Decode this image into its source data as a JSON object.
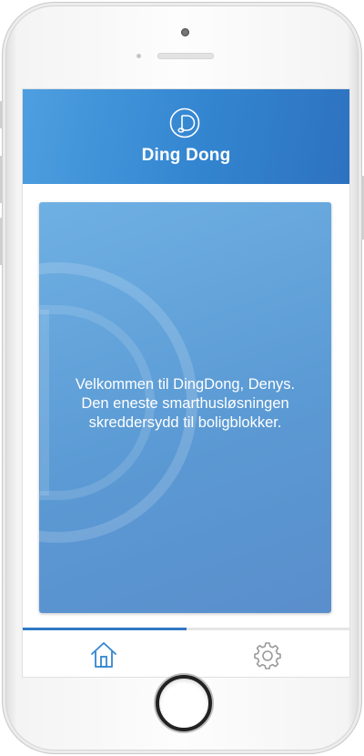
{
  "app": {
    "title": "Ding Dong"
  },
  "welcome": {
    "line1": "Velkommen til DingDong, Denys.",
    "line2": "Den eneste smarthusløsningen",
    "line3": "skreddersydd til boligblokker."
  },
  "progress": {
    "fraction": 0.5
  },
  "tabs": [
    {
      "icon": "home-icon",
      "active": true
    },
    {
      "icon": "gear-icon",
      "active": false
    }
  ],
  "colors": {
    "accent": "#3385d0",
    "card": "#5b9ad4",
    "inactive_icon": "#9a9a9a"
  }
}
